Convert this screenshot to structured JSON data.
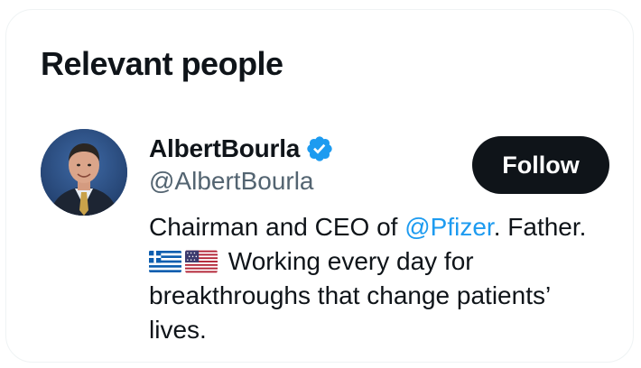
{
  "section": {
    "title": "Relevant people"
  },
  "profile": {
    "display_name": "AlbertBourla",
    "verified_icon": "verified-badge-icon",
    "handle": "@AlbertBourla",
    "follow_label": "Follow",
    "bio": {
      "line1_prefix": "Chairman and CEO of ",
      "line1_mention": "@Pfizer",
      "line1_suffix": ". Father.",
      "flags": [
        "greece-flag-icon",
        "usa-flag-icon"
      ],
      "line2_text": " Working every day for",
      "line3": "breakthroughs that change patients’",
      "line4": "lives."
    }
  },
  "colors": {
    "text_primary": "#0f1419",
    "text_secondary": "#536471",
    "link": "#1d9bf0",
    "verified": "#1d9bf0",
    "button_bg": "#0f1419",
    "button_text": "#ffffff",
    "border": "#eff3f4"
  }
}
